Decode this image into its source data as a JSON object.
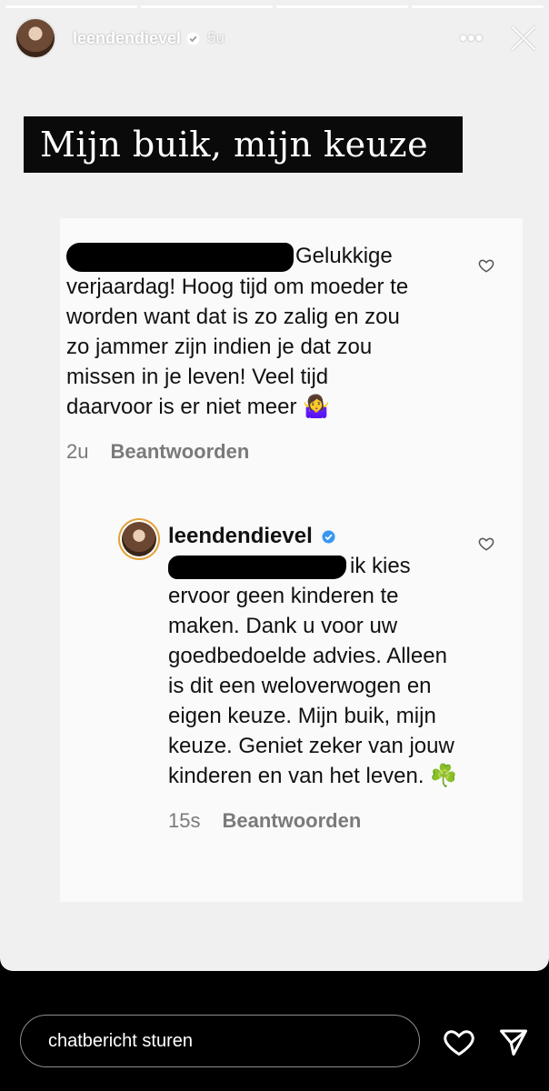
{
  "header": {
    "username": "leendendievel",
    "time": "5u",
    "more": "•••"
  },
  "story": {
    "title": "Mijn buik, mijn keuze",
    "comment": {
      "text_after_redaction": "Gelukkige",
      "text": "verjaardag! Hoog tijd om moeder te worden want dat is zo zalig en zou zo jammer zijn indien je dat zou missen in je leven! Veel tijd daarvoor is er niet meer 🤷‍♀️",
      "age": "2u",
      "reply_label": "Beantwoorden"
    },
    "reply": {
      "username": "leendendievel",
      "text_after_redaction": "ik kies",
      "text": "ervoor geen kinderen te maken. Dank u voor uw goedbedoelde advies. Alleen is dit een weloverwogen en eigen keuze. Mijn buik, mijn keuze. Geniet zeker van jouw kinderen en van het leven. ☘️",
      "age": "15s",
      "reply_label": "Beantwoorden"
    }
  },
  "footer": {
    "input_placeholder": "chatbericht sturen",
    "icons": [
      "heart-icon",
      "send-icon"
    ]
  },
  "colors": {
    "verified": "#3897f0",
    "meta_gray": "#7a7a7a",
    "ring": "#e2a13b"
  }
}
